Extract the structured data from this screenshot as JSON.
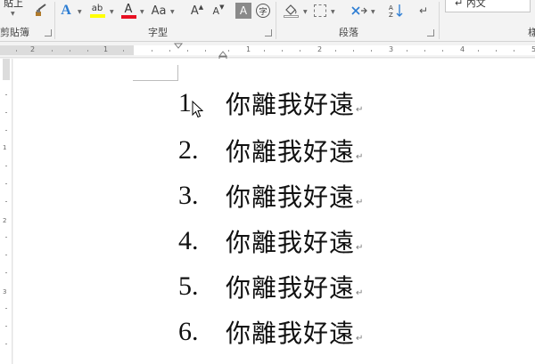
{
  "ribbon": {
    "paste_fragment": "貼上",
    "groups": {
      "clipboard": "剪貼簿",
      "font": "字型",
      "paragraph": "段落",
      "styles_fragment": "樣"
    },
    "font_case_label": "Aa",
    "grow_font_label": "A",
    "shrink_font_label": "A",
    "char_shading_label": "A",
    "phonetic_label": "字",
    "style_body_label": "↵ 內文",
    "colors": {
      "highlight": "#ffff00",
      "font_color": "#e81123",
      "text_effect": "#2b7cd3"
    }
  },
  "ruler": {
    "numbers": [
      "2",
      "1",
      "1",
      "2",
      "3",
      "4",
      "5",
      "6",
      "7"
    ],
    "vertical_numbers": [
      "1",
      "2",
      "3"
    ]
  },
  "document": {
    "lines": [
      {
        "number": "1.",
        "text": "你離我好遠"
      },
      {
        "number": "2.",
        "text": "你離我好遠"
      },
      {
        "number": "3.",
        "text": "你離我好遠"
      },
      {
        "number": "4.",
        "text": "你離我好遠"
      },
      {
        "number": "5.",
        "text": "你離我好遠"
      },
      {
        "number": "6.",
        "text": "你離我好遠"
      }
    ],
    "paragraph_mark": "↵"
  }
}
